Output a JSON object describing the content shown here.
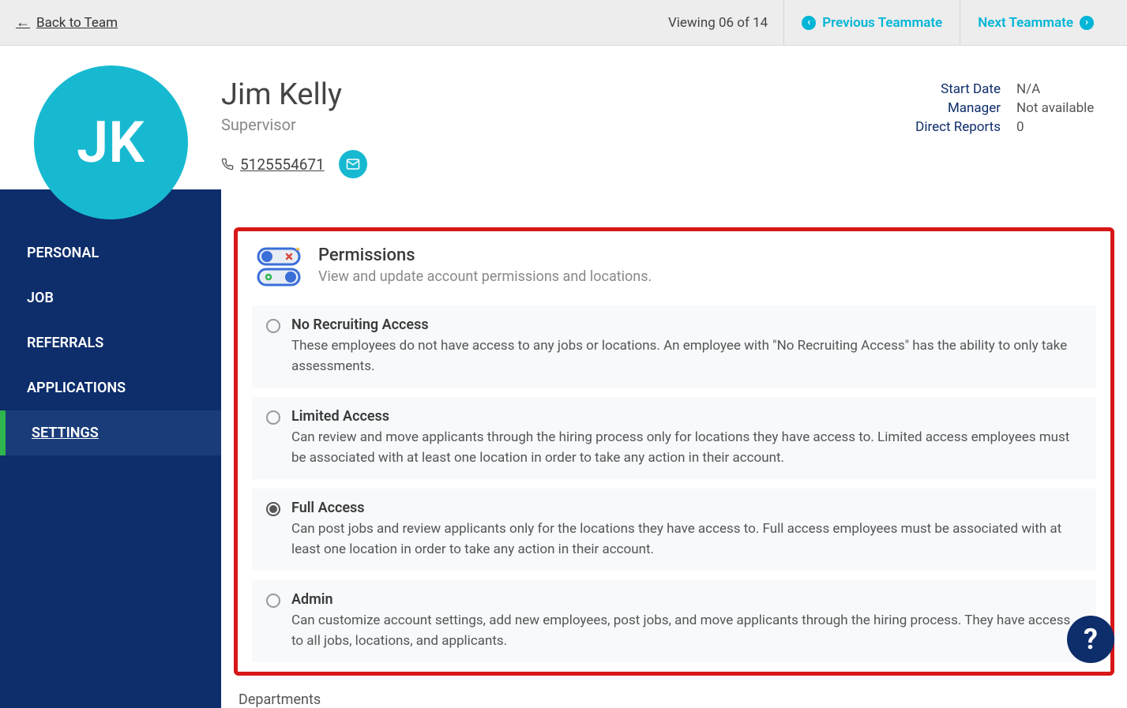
{
  "topbar": {
    "back": "Back to Team",
    "viewing": "Viewing 06 of 14",
    "prev": "Previous Teammate",
    "next": "Next Teammate"
  },
  "profile": {
    "name": "Jim Kelly",
    "role": "Supervisor",
    "initials": "JK",
    "phone": "5125554671"
  },
  "side": {
    "start_date_label": "Start Date",
    "start_date_value": "N/A",
    "manager_label": "Manager",
    "manager_value": "Not available",
    "reports_label": "Direct Reports",
    "reports_value": "0"
  },
  "sidebar": {
    "items": [
      "PERSONAL",
      "JOB",
      "REFERRALS",
      "APPLICATIONS",
      "SETTINGS"
    ],
    "active_index": 4
  },
  "permissions": {
    "heading": "Permissions",
    "subheading": "View and update account permissions and locations.",
    "selected_index": 2,
    "options": [
      {
        "title": "No Recruiting Access",
        "desc": "These employees do not have access to any jobs or locations. An employee with \"No Recruiting Access\" has the ability to only take assessments."
      },
      {
        "title": "Limited Access",
        "desc": "Can review and move applicants through the hiring process only for locations they have access to. Limited access employees must be associated with at least one location in order to take any action in their account."
      },
      {
        "title": "Full Access",
        "desc": "Can post jobs and review applicants only for the locations they have access to. Full access employees must be associated with at least one location in order to take any action in their account."
      },
      {
        "title": "Admin",
        "desc": "Can customize account settings, add new employees, post jobs, and move applicants through the hiring process. They have access to all jobs, locations, and applicants."
      }
    ]
  },
  "departments_label": "Departments",
  "help": "?"
}
